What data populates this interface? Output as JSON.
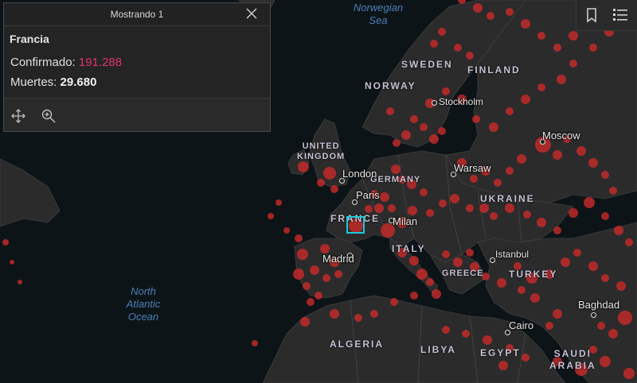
{
  "popup": {
    "header_title": "Mostrando 1",
    "feature_title": "Francia",
    "fields": [
      {
        "label": "Confirmado:",
        "value": "191.288"
      },
      {
        "label": "Muertes:",
        "value": "29.680"
      }
    ],
    "actions": [
      "pan-icon",
      "zoom-to-icon"
    ],
    "value_color_confirmed": "#e2336b"
  },
  "toolbar": {
    "icons": [
      "bookmark-icon",
      "legend-list-icon"
    ]
  },
  "map": {
    "land_color": "#2b2b2b",
    "water_color": "#0d1418",
    "dot_color": "#d62b2b",
    "selection_color": "#1fc8d9",
    "seas": {
      "norwegian": "Norwegian\nSea",
      "atlantic": "North\nAtlantic\nOcean"
    },
    "countries": {
      "sweden": "SWEDEN",
      "finland": "FINLAND",
      "norway": "NORWAY",
      "uk": "UNITED\nKINGDOM",
      "germany": "GERMANY",
      "ukraine": "UKRAINE",
      "france": "FRANCE",
      "italy": "ITALY",
      "greece": "GREECE",
      "turkey": "TURKEY",
      "algeria": "ALGERIA",
      "libya": "LIBYA",
      "egypt": "EGYPT",
      "saudi": "SAUDI\nARABIA"
    },
    "cities": {
      "stockholm": "Stockholm",
      "moscow": "Moscow",
      "warsaw": "Warsaw",
      "london": "London",
      "paris": "Paris",
      "milan": "Milan",
      "madrid": "Madrid",
      "istanbul": "Istanbul",
      "baghdad": "Baghdad",
      "cairo": "Cairo"
    }
  }
}
